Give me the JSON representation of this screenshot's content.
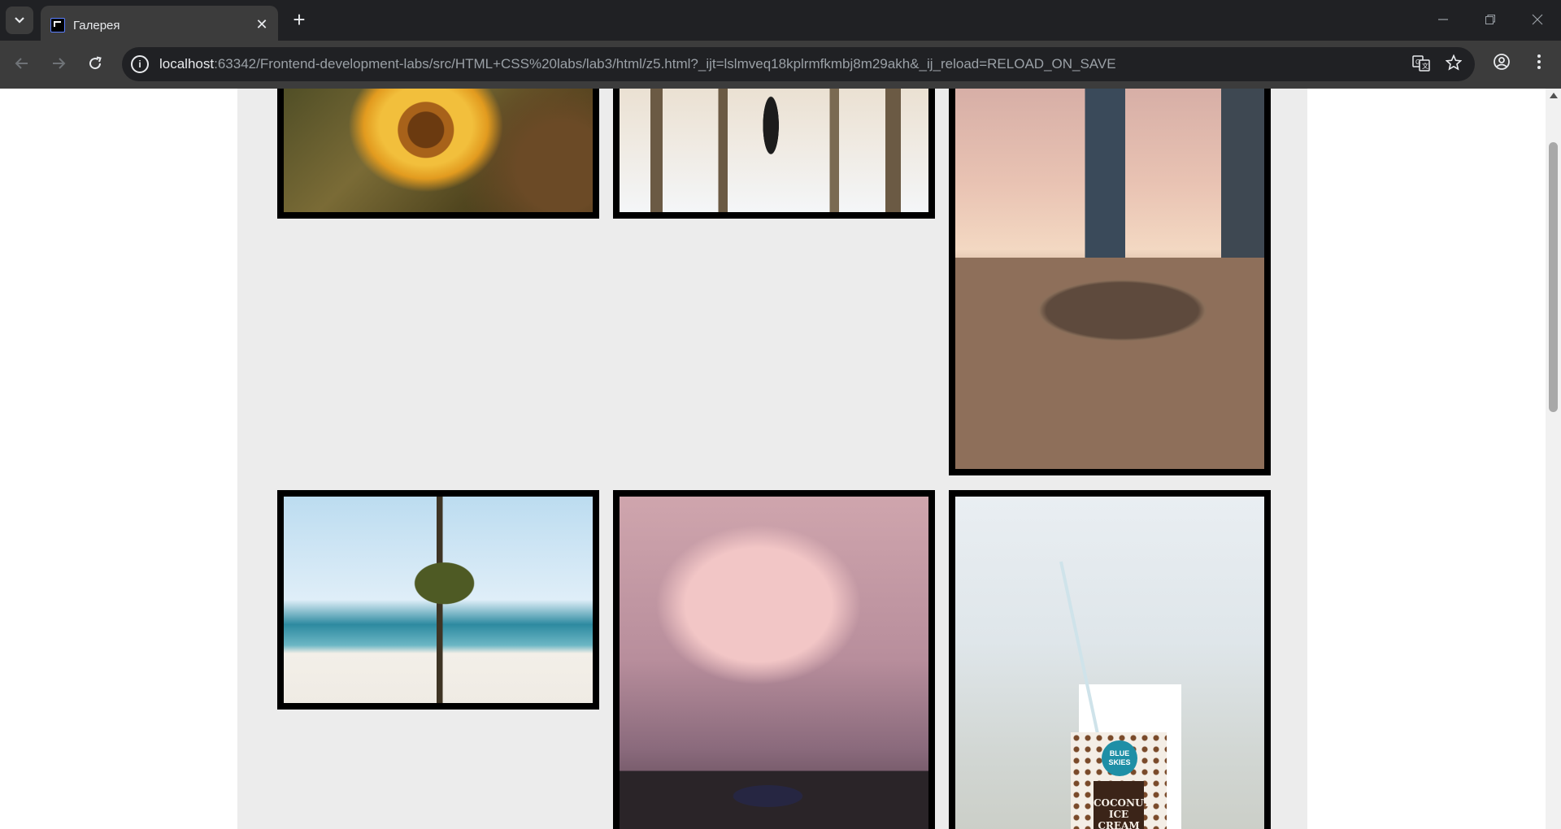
{
  "browser": {
    "tab": {
      "title": "Галерея",
      "close_glyph": "✕"
    },
    "new_tab_glyph": "+",
    "url_host": "localhost",
    "url_rest": ":63342/Frontend-development-labs/src/HTML+CSS%20labs/lab3/html/z5.html?_ijt=lslmveq18kplrmfkmbj8m29akh&_ij_reload=RELOAD_ON_SAVE",
    "icons": {
      "tab_search": "chevron-down-icon",
      "back": "arrow-left-icon",
      "forward": "arrow-right-icon",
      "reload": "reload-icon",
      "site_info": "info-icon",
      "translate": "translate-icon",
      "bookmark": "star-icon",
      "profile": "account-icon",
      "menu": "kebab-menu-icon"
    }
  },
  "gallery": {
    "photos": [
      {
        "subject": "sunflower"
      },
      {
        "subject": "pier"
      },
      {
        "subject": "skateboard"
      },
      {
        "subject": "palm-tree"
      },
      {
        "subject": "surfer"
      },
      {
        "subject": "coconut-ice-cream"
      }
    ],
    "coconut_cup": {
      "badge_text": "BLUE SKIES",
      "label_text": "COCONUT ICE CREAM"
    },
    "frame_color": "#000000",
    "background_color": "#ececec"
  }
}
